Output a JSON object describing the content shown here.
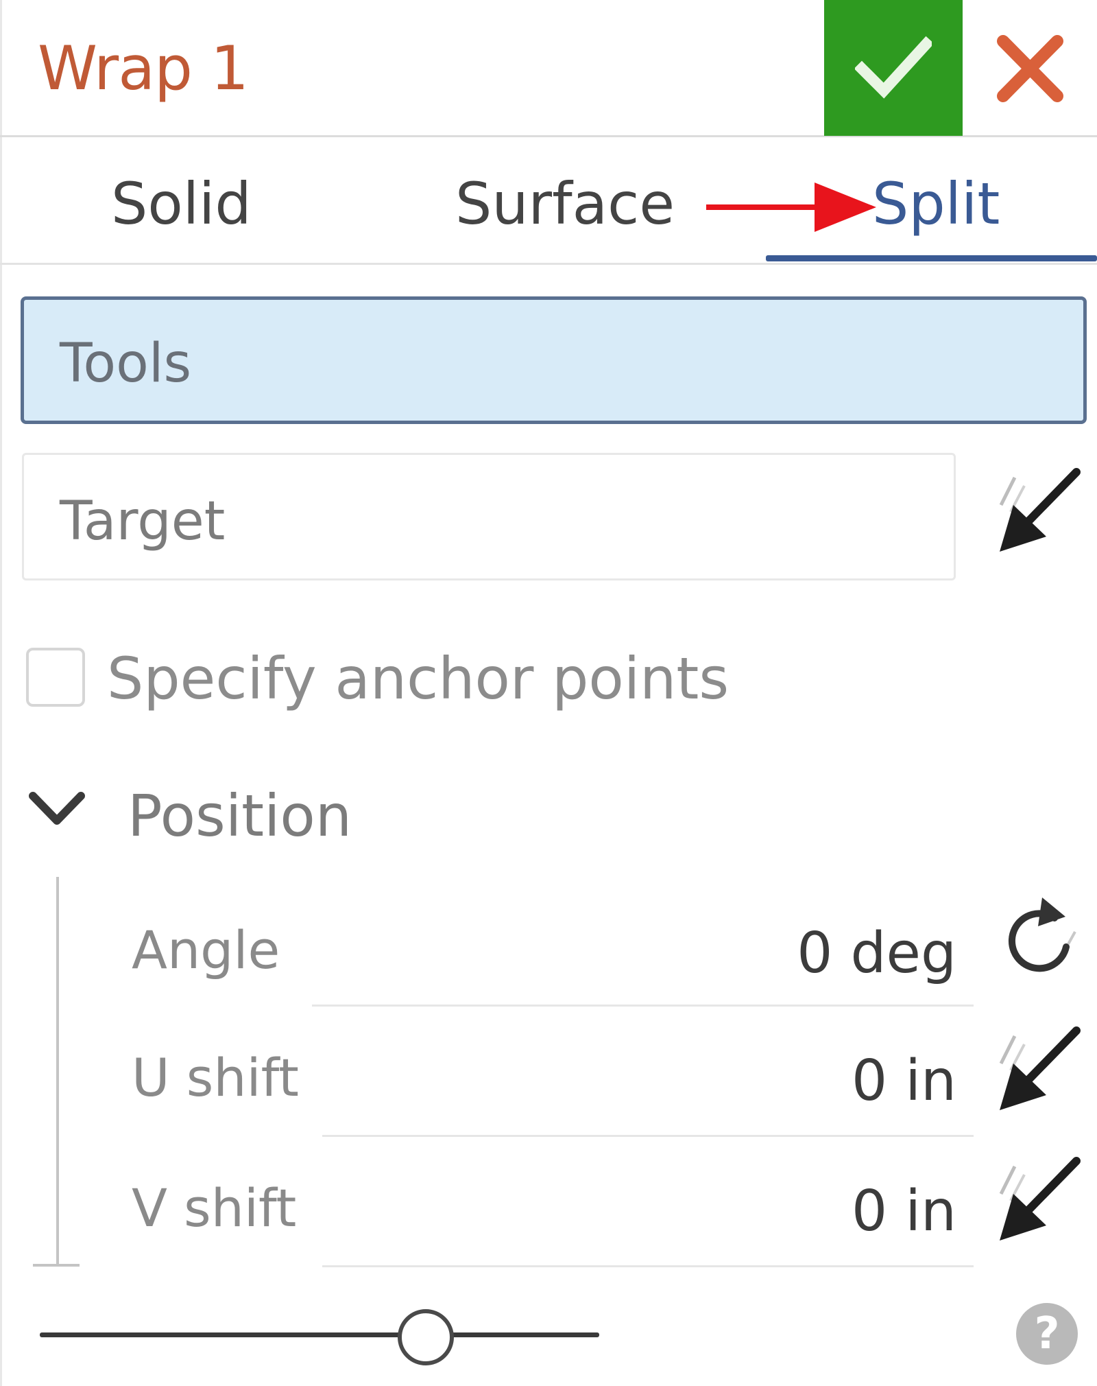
{
  "dialog": {
    "title": "Wrap 1",
    "confirm_icon": "check-icon",
    "cancel_icon": "close-icon"
  },
  "tabs": [
    {
      "label": "Solid",
      "selected": false
    },
    {
      "label": "Surface",
      "selected": false
    },
    {
      "label": "Split",
      "selected": true
    }
  ],
  "fields": {
    "tools": {
      "label": "Tools",
      "active": true
    },
    "target": {
      "label": "Target"
    }
  },
  "anchor_points": {
    "label": "Specify anchor points",
    "checked": false
  },
  "position": {
    "label": "Position",
    "expanded": true,
    "params": [
      {
        "label": "Angle",
        "value": "0 deg",
        "icon": "reset-rotate-icon"
      },
      {
        "label": "U shift",
        "value": "0 in",
        "icon": "pick-arrow-icon"
      },
      {
        "label": "V shift",
        "value": "0 in",
        "icon": "pick-arrow-icon"
      }
    ]
  },
  "footer": {
    "slider_value": 0.69,
    "help_label": "?"
  },
  "colors": {
    "title": "#c05a36",
    "confirm": "#2e9a20",
    "cancel": "#d9603a",
    "selected_tab": "#3a5a94",
    "active_field": "#d8ebf8",
    "annotation_arrow": "#e8141c"
  }
}
